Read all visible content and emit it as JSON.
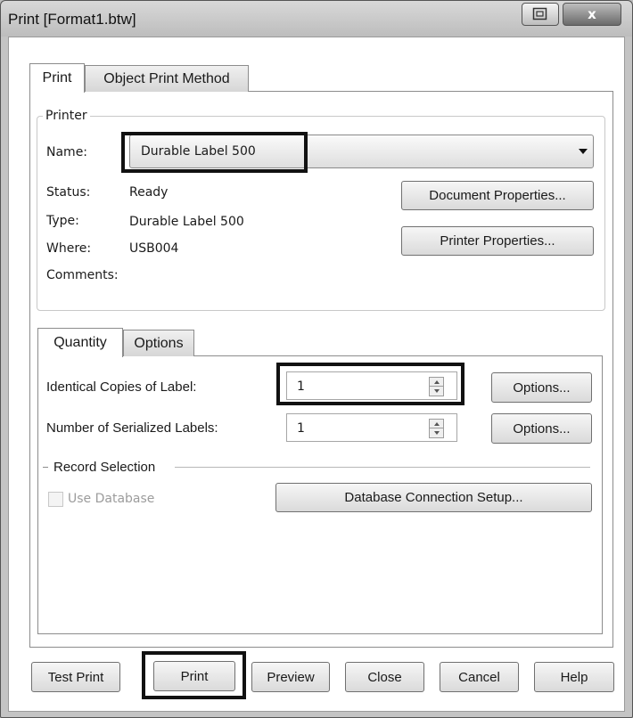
{
  "window": {
    "title": "Print [Format1.btw]",
    "close_glyph": "x"
  },
  "tabs": {
    "print": "Print",
    "object_print_method": "Object Print Method"
  },
  "printer": {
    "legend": "Printer",
    "name_label": "Name:",
    "selected_printer": "Durable Label 500",
    "status_label": "Status:",
    "status_value": "Ready",
    "type_label": "Type:",
    "type_value": "Durable Label 500",
    "where_label": "Where:",
    "where_value": "USB004",
    "comments_label": "Comments:",
    "document_properties_button": "Document Properties...",
    "printer_properties_button": "Printer Properties..."
  },
  "inner_tabs": {
    "quantity": "Quantity",
    "options": "Options"
  },
  "quantity": {
    "identical_copies_label": "Identical Copies of Label:",
    "identical_copies_value": "1",
    "serialized_labels_label": "Number of Serialized Labels:",
    "serialized_labels_value": "1",
    "options_button_1": "Options...",
    "options_button_2": "Options..."
  },
  "record_selection": {
    "legend": "Record Selection",
    "use_database_label": "Use Database",
    "use_database_checked": false,
    "database_connection_button": "Database Connection Setup..."
  },
  "footer": {
    "test_print": "Test Print",
    "print": "Print",
    "preview": "Preview",
    "close": "Close",
    "cancel": "Cancel",
    "help": "Help"
  },
  "icons": {
    "restore": "restore-icon",
    "close": "close-icon",
    "dropdown": "chevron-down-icon"
  }
}
